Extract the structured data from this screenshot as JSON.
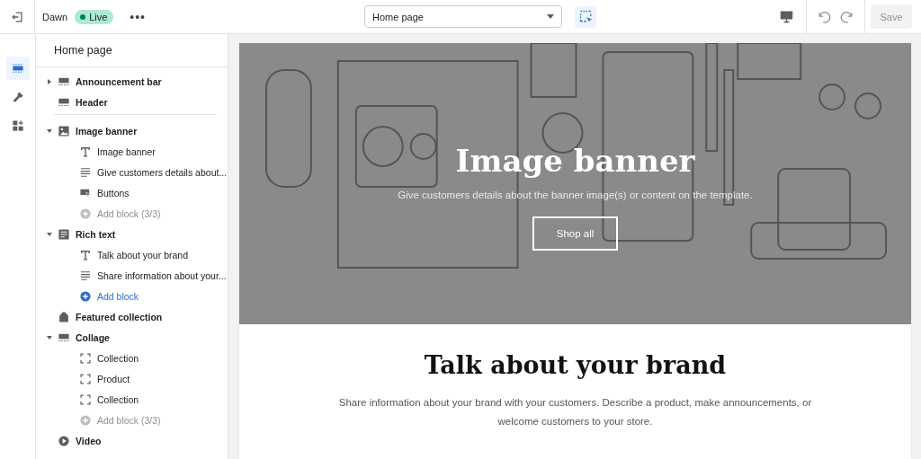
{
  "topbar": {
    "theme_name": "Dawn",
    "status_badge": "Live",
    "more_button": "•••",
    "page_select": "Home page",
    "save_button": {
      "label": "Save",
      "disabled": true
    },
    "select_tool_active": true
  },
  "rail": [
    {
      "selected": true
    },
    {
      "selected": false
    },
    {
      "selected": false
    }
  ],
  "sidebar": {
    "title": "Home page",
    "sections": [
      {
        "label": "Announcement bar",
        "kind": "bar",
        "expanded": false
      },
      {
        "label": "Header",
        "kind": "bar",
        "divider_after": true
      },
      {
        "label": "Image banner",
        "kind": "image",
        "expanded": true,
        "blocks": [
          {
            "label": "Image banner",
            "kind": "heading"
          },
          {
            "label": "Give customers details about...",
            "kind": "text"
          },
          {
            "label": "Buttons",
            "kind": "buttons"
          },
          {
            "label": "Add block (3/3)",
            "kind": "add",
            "disabled": true
          }
        ]
      },
      {
        "label": "Rich text",
        "kind": "text",
        "expanded": true,
        "blocks": [
          {
            "label": "Talk about your brand",
            "kind": "heading"
          },
          {
            "label": "Share information about your...",
            "kind": "text"
          },
          {
            "label": "Add block",
            "kind": "add",
            "disabled": false
          }
        ]
      },
      {
        "label": "Featured collection",
        "kind": "tag"
      },
      {
        "label": "Collage",
        "kind": "bar",
        "expanded": true,
        "blocks": [
          {
            "label": "Collection",
            "kind": "frame"
          },
          {
            "label": "Product",
            "kind": "frame"
          },
          {
            "label": "Collection",
            "kind": "frame"
          },
          {
            "label": "Add block (3/3)",
            "kind": "add",
            "disabled": true
          }
        ]
      },
      {
        "label": "Video",
        "kind": "video"
      }
    ]
  },
  "preview": {
    "banner": {
      "heading": "Image banner",
      "text": "Give customers details about the banner image(s) or content on the template.",
      "button": "Shop all"
    },
    "rich_text": {
      "heading": "Talk about your brand",
      "text": "Share information about your brand with your customers. Describe a product, make announcements, or welcome customers to your store."
    }
  }
}
